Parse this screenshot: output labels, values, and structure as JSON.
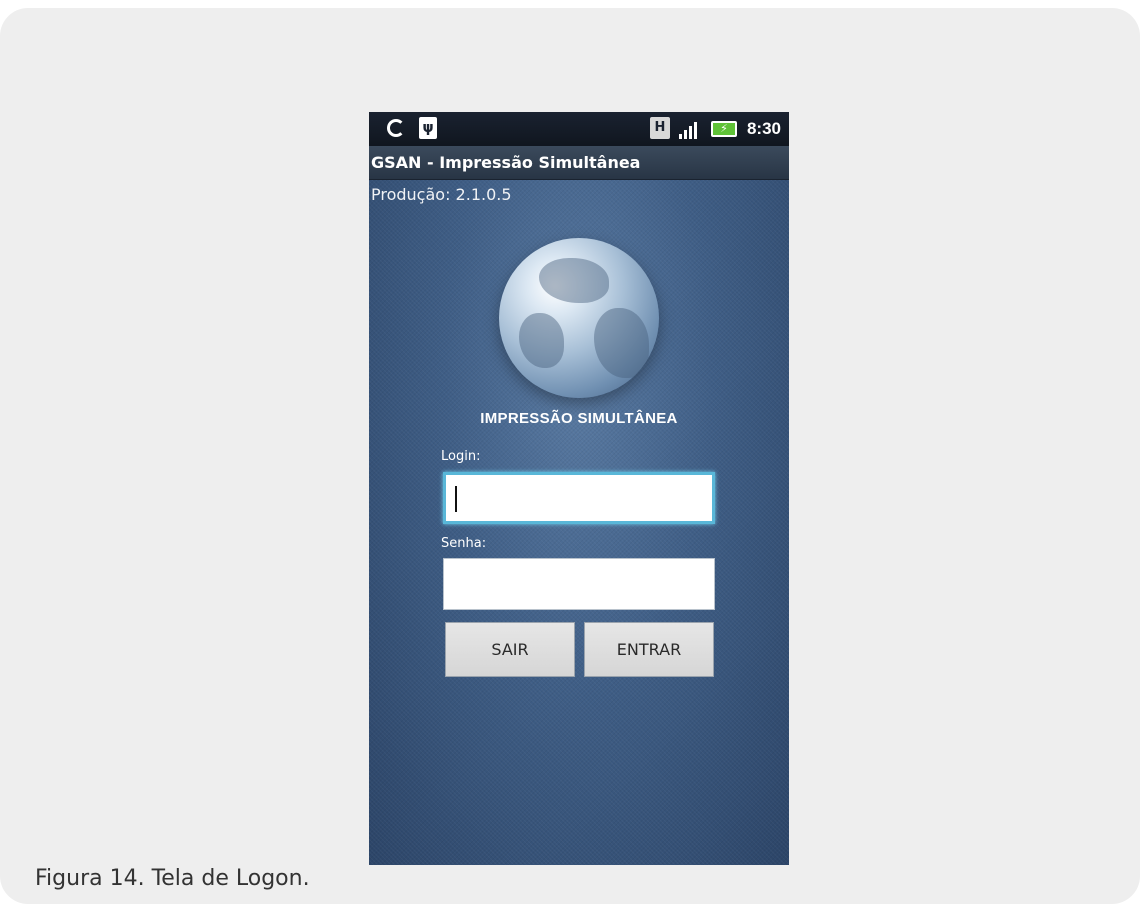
{
  "status_bar": {
    "sync_icon": "sync-icon",
    "usb_icon": "usb-icon",
    "h_indicator": "H",
    "signal_icon": "signal-icon",
    "battery_icon": "battery-charging-icon",
    "time": "8:30"
  },
  "app": {
    "title": "GSAN - Impressão Simultânea",
    "version": "Produção: 2.1.0.5",
    "heading": "IMPRESSÃO SIMULTÂNEA",
    "logo_icon": "globe-icon"
  },
  "form": {
    "login_label": "Login:",
    "login_value": "",
    "senha_label": "Senha:",
    "senha_value": "",
    "sair_label": "SAIR",
    "entrar_label": "ENTRAR"
  },
  "caption": "Figura 14. Tela de Logon.",
  "colors": {
    "background": "#3f5e86",
    "focus_border": "#59b7d8",
    "battery": "#5fc237"
  }
}
